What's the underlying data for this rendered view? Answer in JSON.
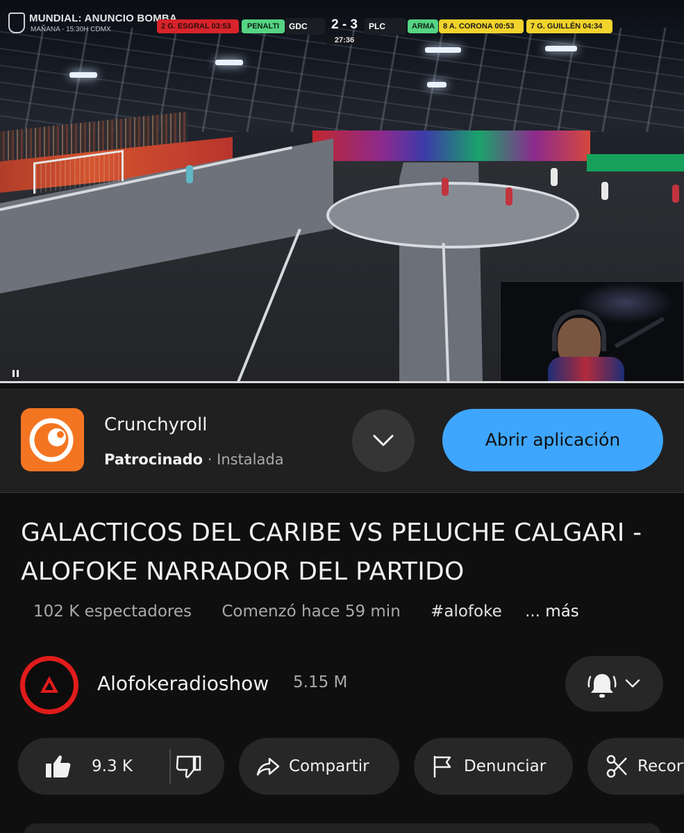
{
  "video": {
    "overlay": {
      "promo_title": "MUNDIAL: ANUNCIO BOMBA",
      "promo_subtitle": "MAÑANA - 15:30H CDMX",
      "left_penalty": "2 G. ESGRAL 03:53",
      "penalty_label": "PENALTI",
      "home_team": "GDC",
      "score": "2 - 3",
      "away_team": "PLC",
      "clock": "27:36",
      "weapon_label": "ARMA",
      "right_penalty_1": "8 A. CORONA 00:53",
      "right_penalty_2": "7 G. GUILLÉN 04:34"
    },
    "progress_fraction": 1.0,
    "state": "playing"
  },
  "ad": {
    "app_name": "Crunchyroll",
    "sponsored_label": "Patrocinado",
    "dot": "·",
    "status": "Instalada",
    "open_button": "Abrir aplicación",
    "brand_color": "#f47521",
    "button_color": "#3ea6ff"
  },
  "video_info": {
    "title": "GALACTICOS DEL CARIBE VS PELUCHE CALGARI - ALOFOKE NARRADOR DEL PARTIDO",
    "viewers": "102 K espectadores",
    "started": "Comenzó hace 59 min",
    "hashtag": "#alofoke",
    "more": "... más"
  },
  "channel": {
    "name": "Alofokeradioshow",
    "subscribers": "5.15 M",
    "accent_color": "#e11b1b"
  },
  "actions": {
    "likes": "9.3 K",
    "share": "Compartir",
    "report": "Denunciar",
    "clip": "Recortar"
  }
}
